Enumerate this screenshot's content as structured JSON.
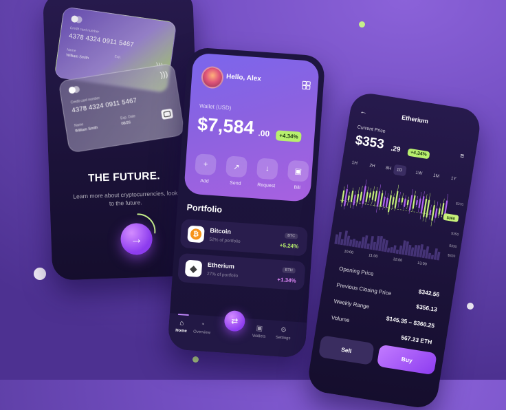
{
  "onboarding": {
    "card_back": {
      "caption": "Credit card number",
      "number": "4378 4324 0911 5467",
      "name_label": "Name",
      "name": "William Smith",
      "exp_label": "Exp."
    },
    "card_front": {
      "caption": "Credit card number",
      "number": "4378 4324 0911 5467",
      "name_label": "Name",
      "name": "William Smith",
      "exp_label": "Exp. Date",
      "exp": "08/26"
    },
    "title": "THE FUTURE.",
    "subtitle": "Learn more about cryptocurrencies, look to the future.",
    "next_icon": "arrow-right-icon",
    "progress_fraction": 0.33
  },
  "home": {
    "greeting": "Hello, Alex",
    "wallet_label": "Wallet (USD)",
    "balance_main": "$7,584",
    "balance_cents": ".00",
    "balance_change": "+4.34%",
    "actions": [
      {
        "label": "Add",
        "icon": "plus-icon"
      },
      {
        "label": "Send",
        "icon": "send-icon"
      },
      {
        "label": "Request",
        "icon": "download-icon"
      },
      {
        "label": "Bill",
        "icon": "wallet-icon"
      }
    ],
    "portfolio_title": "Portfolio",
    "assets": [
      {
        "name": "Bitcoin",
        "share": "52% of portfolio",
        "ticker": "BTC",
        "change": "+5.24%",
        "change_color": "#b8f06e",
        "icon": "bitcoin-icon"
      },
      {
        "name": "Etherium",
        "share": "27% of portfolio",
        "ticker": "ETH",
        "change": "+1.34%",
        "change_color": "#e58cff",
        "icon": "ethereum-icon"
      }
    ],
    "nav": [
      {
        "label": "Home",
        "icon": "home-icon"
      },
      {
        "label": "Overview",
        "icon": "pie-chart-icon"
      },
      {
        "label": "Wallets",
        "icon": "wallet-icon"
      },
      {
        "label": "Settings",
        "icon": "gear-icon"
      }
    ],
    "nav_center_icon": "swap-icon"
  },
  "detail": {
    "title": "Etherium",
    "current_label": "Current Price",
    "price_main": "$353",
    "price_cents": ".29",
    "price_change": "+4.34%",
    "timeframes": [
      "1H",
      "2H",
      "8H",
      "1D",
      "1W",
      "1M",
      "1Y"
    ],
    "active_timeframe": "1D",
    "price_ticks": [
      "$370",
      "$360",
      "$350",
      "$330",
      "$320"
    ],
    "time_ticks": [
      "10:00",
      "11:00",
      "12:00",
      "13:00"
    ],
    "current_marker": "$360",
    "stats": [
      {
        "label": "Opening Price",
        "value": ""
      },
      {
        "label": "Previous Closing Price",
        "value": "$342.56"
      },
      {
        "label": "Weekly Range",
        "value": "$356.13"
      },
      {
        "label": "Volume",
        "value": "$145.35 – $360.25"
      },
      {
        "label": "",
        "value": "567.23 ETH"
      }
    ],
    "sell_label": "Sell",
    "buy_label": "Buy"
  },
  "colors": {
    "accent_green": "#b8f06e",
    "accent_purple": "#a861e0",
    "candle_green": "#c7f07a",
    "candle_purple": "#b064f2"
  }
}
